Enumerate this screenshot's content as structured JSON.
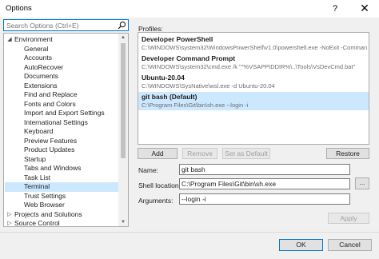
{
  "window": {
    "title": "Options",
    "help_glyph": "?",
    "close_glyph": "✕"
  },
  "search": {
    "placeholder": "Search Options (Ctrl+E)"
  },
  "tree": {
    "items": [
      {
        "label": "Environment",
        "arrow": "◢",
        "level": 0
      },
      {
        "label": "General",
        "level": 1
      },
      {
        "label": "Accounts",
        "level": 1
      },
      {
        "label": "AutoRecover",
        "level": 1
      },
      {
        "label": "Documents",
        "level": 1
      },
      {
        "label": "Extensions",
        "level": 1
      },
      {
        "label": "Find and Replace",
        "level": 1
      },
      {
        "label": "Fonts and Colors",
        "level": 1
      },
      {
        "label": "Import and Export Settings",
        "level": 1
      },
      {
        "label": "International Settings",
        "level": 1
      },
      {
        "label": "Keyboard",
        "level": 1
      },
      {
        "label": "Preview Features",
        "level": 1
      },
      {
        "label": "Product Updates",
        "level": 1
      },
      {
        "label": "Startup",
        "level": 1
      },
      {
        "label": "Tabs and Windows",
        "level": 1
      },
      {
        "label": "Task List",
        "level": 1
      },
      {
        "label": "Terminal",
        "level": 1,
        "selected": true
      },
      {
        "label": "Trust Settings",
        "level": 1
      },
      {
        "label": "Web Browser",
        "level": 1
      },
      {
        "label": "Projects and Solutions",
        "arrow": "▷",
        "level": 0
      },
      {
        "label": "Source Control",
        "arrow": "▷",
        "level": 0
      }
    ]
  },
  "profiles": {
    "label": "Profiles:",
    "items": [
      {
        "name": "Developer PowerShell",
        "command": "C:\\WINDOWS\\system32\\WindowsPowerShell\\v1.0\\powershell.exe -NoExit -Comman"
      },
      {
        "name": "Developer Command Prompt",
        "command": "C:\\WINDOWS\\system32\\cmd.exe /k \"\"%VSAPPIDDIR%\\..\\Tools\\VsDevCmd.bat\""
      },
      {
        "name": "Ubuntu-20.04",
        "command": "C:\\WINDOWS\\SysNative\\wsl.exe -d Ubuntu-20.04"
      },
      {
        "name": "git bash (Default)",
        "command": "C:\\Program Files\\Git\\bin\\sh.exe --login -i",
        "selected": true
      }
    ]
  },
  "buttons": {
    "add": "Add",
    "remove": "Remove",
    "set_default": "Set as Default",
    "restore": "Restore",
    "browse": "...",
    "apply": "Apply",
    "ok": "OK",
    "cancel": "Cancel"
  },
  "form": {
    "name_label": "Name:",
    "name_value": "git bash",
    "shell_label": "Shell location:",
    "shell_value": "C:\\Program Files\\Git\\bin\\sh.exe",
    "args_label": "Arguments:",
    "args_value": "--login -i"
  }
}
